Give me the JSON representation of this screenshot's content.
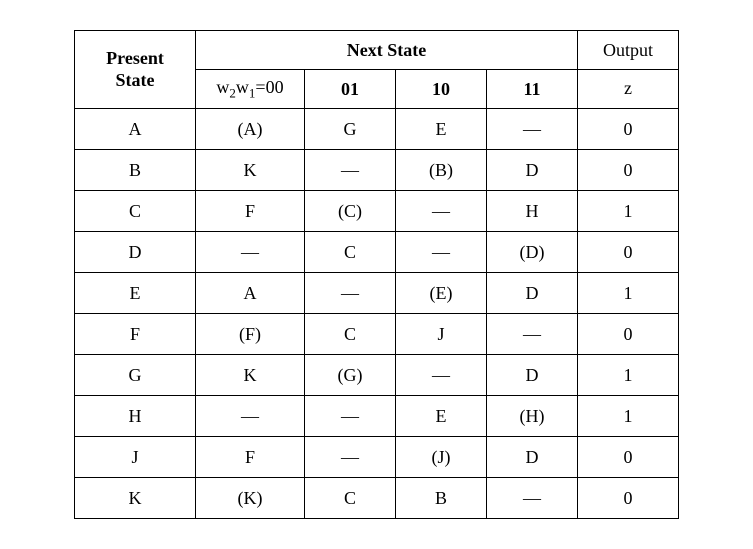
{
  "headers": {
    "present_state": "Present State",
    "next_state": "Next State",
    "output_top": "Output",
    "output_sub": "z",
    "w_label_prefix": "w",
    "w_sub1": "2",
    "w_sub2": "1",
    "w_eq": "=00",
    "col01": "01",
    "col10": "10",
    "col11": "11"
  },
  "rows": [
    {
      "present": "A",
      "c00": "(A)",
      "c01": "G",
      "c10": "E",
      "c11": "—",
      "z": "0"
    },
    {
      "present": "B",
      "c00": "K",
      "c01": "—",
      "c10": "(B)",
      "c11": "D",
      "z": "0"
    },
    {
      "present": "C",
      "c00": "F",
      "c01": "(C)",
      "c10": "—",
      "c11": "H",
      "z": "1"
    },
    {
      "present": "D",
      "c00": "—",
      "c01": "C",
      "c10": "—",
      "c11": "(D)",
      "z": "0"
    },
    {
      "present": "E",
      "c00": "A",
      "c01": "—",
      "c10": "(E)",
      "c11": "D",
      "z": "1"
    },
    {
      "present": "F",
      "c00": "(F)",
      "c01": "C",
      "c10": "J",
      "c11": "—",
      "z": "0"
    },
    {
      "present": "G",
      "c00": "K",
      "c01": "(G)",
      "c10": "—",
      "c11": "D",
      "z": "1"
    },
    {
      "present": "H",
      "c00": "—",
      "c01": "—",
      "c10": "E",
      "c11": "(H)",
      "z": "1"
    },
    {
      "present": "J",
      "c00": "F",
      "c01": "—",
      "c10": "(J)",
      "c11": "D",
      "z": "0"
    },
    {
      "present": "K",
      "c00": "(K)",
      "c01": "C",
      "c10": "B",
      "c11": "—",
      "z": "0"
    }
  ]
}
